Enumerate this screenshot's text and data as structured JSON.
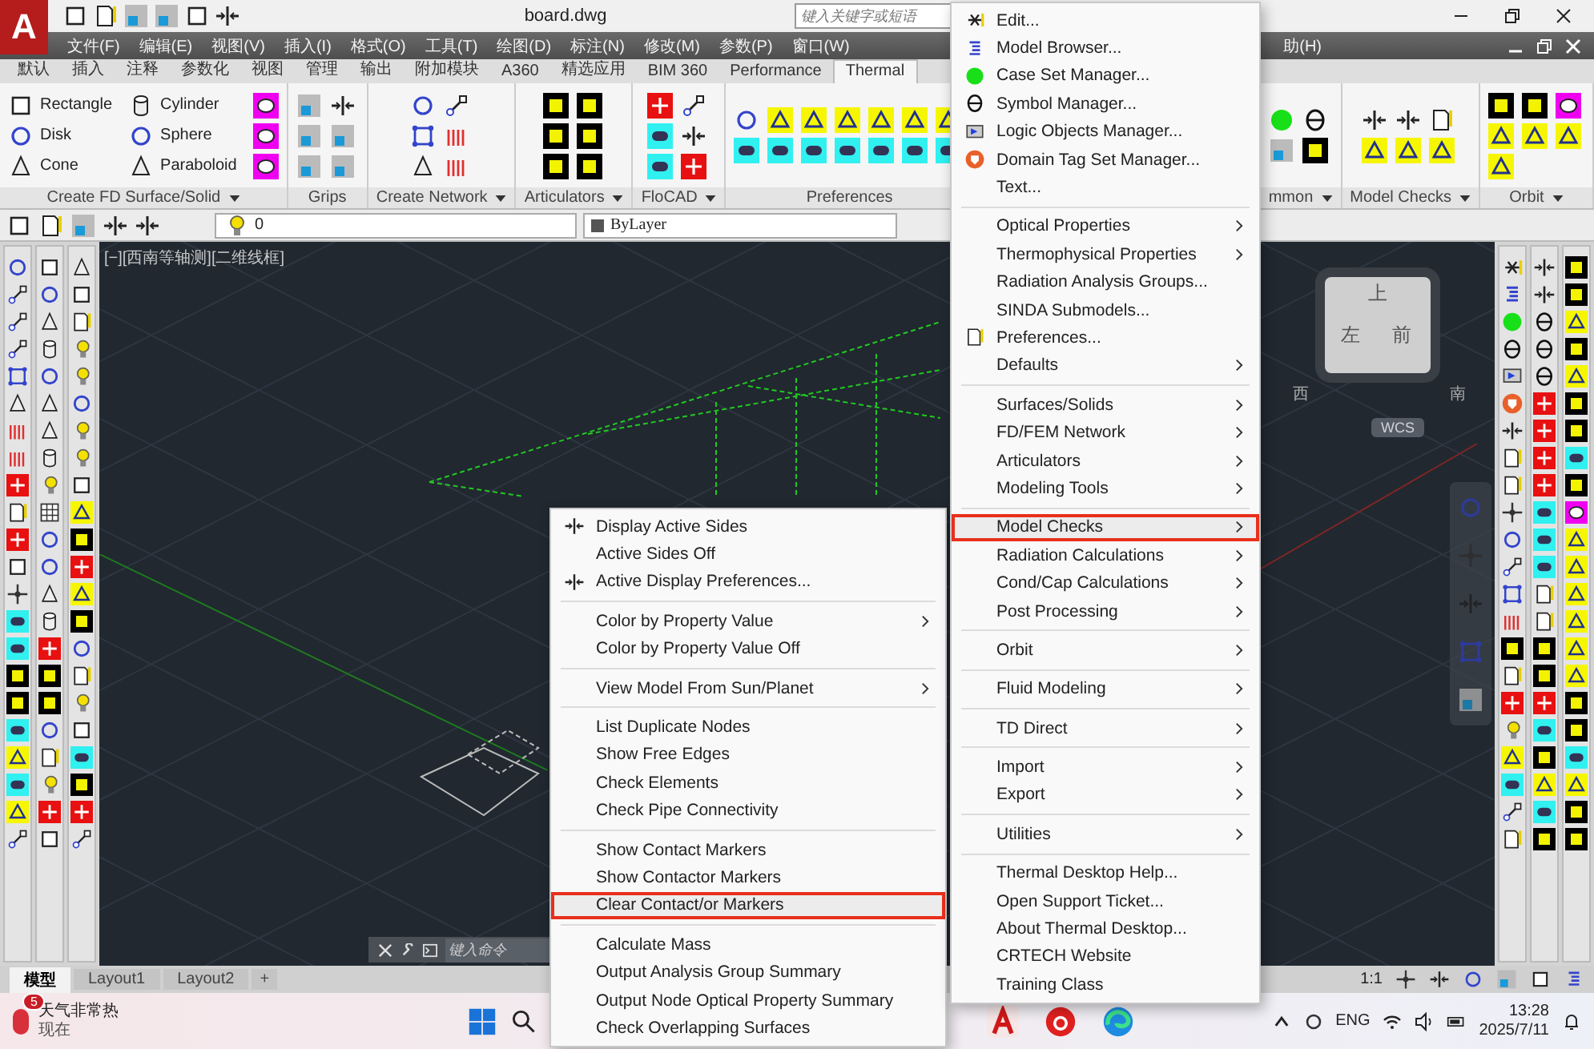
{
  "title_bar": {
    "app_logo": "A",
    "title": "board.dwg",
    "search_placeholder": "键入关键字或短语"
  },
  "menu_bar": [
    "文件(F)",
    "编辑(E)",
    "视图(V)",
    "插入(I)",
    "格式(O)",
    "工具(T)",
    "绘图(D)",
    "标注(N)",
    "修改(M)",
    "参数(P)",
    "窗口(W)",
    "助(H)"
  ],
  "ribbon_tabs": [
    {
      "label": "默认",
      "selected": false
    },
    {
      "label": "插入",
      "selected": false
    },
    {
      "label": "注释",
      "selected": false
    },
    {
      "label": "参数化",
      "selected": false
    },
    {
      "label": "视图",
      "selected": false
    },
    {
      "label": "管理",
      "selected": false
    },
    {
      "label": "输出",
      "selected": false
    },
    {
      "label": "附加模块",
      "selected": false
    },
    {
      "label": "A360",
      "selected": false
    },
    {
      "label": "精选应用",
      "selected": false
    },
    {
      "label": "BIM 360",
      "selected": false
    },
    {
      "label": "Performance",
      "selected": false
    },
    {
      "label": "Thermal",
      "selected": true
    }
  ],
  "ribbon_panels": [
    {
      "title": "Create FD Surface/Solid",
      "dropdown": true,
      "items": [
        "Rectangle",
        "Cylinder",
        "Disk",
        "Sphere",
        "Cone",
        "Paraboloid"
      ]
    },
    {
      "title": "Grips",
      "dropdown": false
    },
    {
      "title": "Create Network",
      "dropdown": true
    },
    {
      "title": "Articulators",
      "dropdown": true
    },
    {
      "title": "FloCAD",
      "dropdown": true
    },
    {
      "title": "Preferences",
      "dropdown": false
    },
    {
      "title": "mmon",
      "dropdown": true
    },
    {
      "title": "Model Checks",
      "dropdown": true
    },
    {
      "title": "Orbit",
      "dropdown": true
    }
  ],
  "properties_bar": {
    "layer": "0",
    "linetype": "ByLayer"
  },
  "viewport": {
    "label": "[−][西南等轴测][二维线框]",
    "cube_faces": [
      "上",
      "左",
      "前"
    ],
    "compass": [
      "西",
      "南"
    ],
    "ucs": "WCS"
  },
  "command_line": {
    "placeholder": "键入命令"
  },
  "layout_tabs": [
    {
      "label": "模型",
      "selected": true
    },
    {
      "label": "Layout1",
      "selected": false
    },
    {
      "label": "Layout2",
      "selected": false
    }
  ],
  "add_layout": "+",
  "status_bar": {
    "scale": "1:1"
  },
  "context_menu": [
    [
      {
        "label": "Display Active Sides",
        "submenu": false,
        "highlighted": false
      },
      {
        "label": "Active Sides Off",
        "submenu": false,
        "highlighted": false
      },
      {
        "label": "Active Display Preferences...",
        "submenu": false,
        "highlighted": false
      }
    ],
    [
      {
        "label": "Color by Property Value",
        "submenu": true,
        "highlighted": false
      },
      {
        "label": "Color by Property Value Off",
        "submenu": false,
        "highlighted": false
      }
    ],
    [
      {
        "label": "View Model From Sun/Planet",
        "submenu": true,
        "highlighted": false
      }
    ],
    [
      {
        "label": "List Duplicate Nodes",
        "submenu": false,
        "highlighted": false
      },
      {
        "label": "Show Free Edges",
        "submenu": false,
        "highlighted": false
      },
      {
        "label": "Check Elements",
        "submenu": false,
        "highlighted": false
      },
      {
        "label": "Check Pipe Connectivity",
        "submenu": false,
        "highlighted": false
      }
    ],
    [
      {
        "label": "Show Contact Markers",
        "submenu": false,
        "highlighted": false
      },
      {
        "label": "Show Contactor Markers",
        "submenu": false,
        "highlighted": false
      },
      {
        "label": "Clear Contact/or Markers",
        "submenu": false,
        "highlighted": true
      }
    ],
    [
      {
        "label": "Calculate Mass",
        "submenu": false,
        "highlighted": false
      },
      {
        "label": "Output Analysis Group Summary",
        "submenu": false,
        "highlighted": false
      },
      {
        "label": "Output Node Optical Property Summary",
        "submenu": false,
        "highlighted": false
      },
      {
        "label": "Check Overlapping Surfaces",
        "submenu": false,
        "highlighted": false
      }
    ]
  ],
  "main_menu": [
    [
      {
        "label": "Edit...",
        "submenu": false,
        "highlighted": false
      },
      {
        "label": "Model Browser...",
        "submenu": false,
        "highlighted": false
      },
      {
        "label": "Case Set Manager...",
        "submenu": false,
        "highlighted": false
      },
      {
        "label": "Symbol Manager...",
        "submenu": false,
        "highlighted": false
      },
      {
        "label": "Logic Objects Manager...",
        "submenu": false,
        "highlighted": false
      },
      {
        "label": "Domain Tag Set Manager...",
        "submenu": false,
        "highlighted": false
      },
      {
        "label": "Text...",
        "submenu": false,
        "highlighted": false
      }
    ],
    [
      {
        "label": "Optical Properties",
        "submenu": true,
        "highlighted": false
      },
      {
        "label": "Thermophysical Properties",
        "submenu": true,
        "highlighted": false
      },
      {
        "label": "Radiation Analysis Groups...",
        "submenu": false,
        "highlighted": false
      },
      {
        "label": "SINDA Submodels...",
        "submenu": false,
        "highlighted": false
      },
      {
        "label": "Preferences...",
        "submenu": false,
        "highlighted": false
      },
      {
        "label": "Defaults",
        "submenu": true,
        "highlighted": false
      }
    ],
    [
      {
        "label": "Surfaces/Solids",
        "submenu": true,
        "highlighted": false
      },
      {
        "label": "FD/FEM Network",
        "submenu": true,
        "highlighted": false
      },
      {
        "label": "Articulators",
        "submenu": true,
        "highlighted": false
      },
      {
        "label": "Modeling Tools",
        "submenu": true,
        "highlighted": false
      }
    ],
    [
      {
        "label": "Model Checks",
        "submenu": true,
        "highlighted": true
      },
      {
        "label": "Radiation Calculations",
        "submenu": true,
        "highlighted": false
      },
      {
        "label": "Cond/Cap Calculations",
        "submenu": true,
        "highlighted": false
      },
      {
        "label": "Post Processing",
        "submenu": true,
        "highlighted": false
      }
    ],
    [
      {
        "label": "Orbit",
        "submenu": true,
        "highlighted": false
      }
    ],
    [
      {
        "label": "Fluid Modeling",
        "submenu": true,
        "highlighted": false
      }
    ],
    [
      {
        "label": "TD Direct",
        "submenu": true,
        "highlighted": false
      }
    ],
    [
      {
        "label": "Import",
        "submenu": true,
        "highlighted": false
      },
      {
        "label": "Export",
        "submenu": true,
        "highlighted": false
      }
    ],
    [
      {
        "label": "Utilities",
        "submenu": true,
        "highlighted": false
      }
    ],
    [
      {
        "label": "Thermal Desktop Help...",
        "submenu": false,
        "highlighted": false
      },
      {
        "label": "Open Support Ticket...",
        "submenu": false,
        "highlighted": false
      },
      {
        "label": "About Thermal Desktop...",
        "submenu": false,
        "highlighted": false
      },
      {
        "label": "CRTECH Website",
        "submenu": false,
        "highlighted": false
      },
      {
        "label": "Training Class",
        "submenu": false,
        "highlighted": false
      }
    ]
  ],
  "taskbar": {
    "weather_badge": "5",
    "weather": "天气非常热",
    "weather_note": "现在",
    "language": "ENG",
    "time": "13:28",
    "date": "2025/7/11"
  }
}
